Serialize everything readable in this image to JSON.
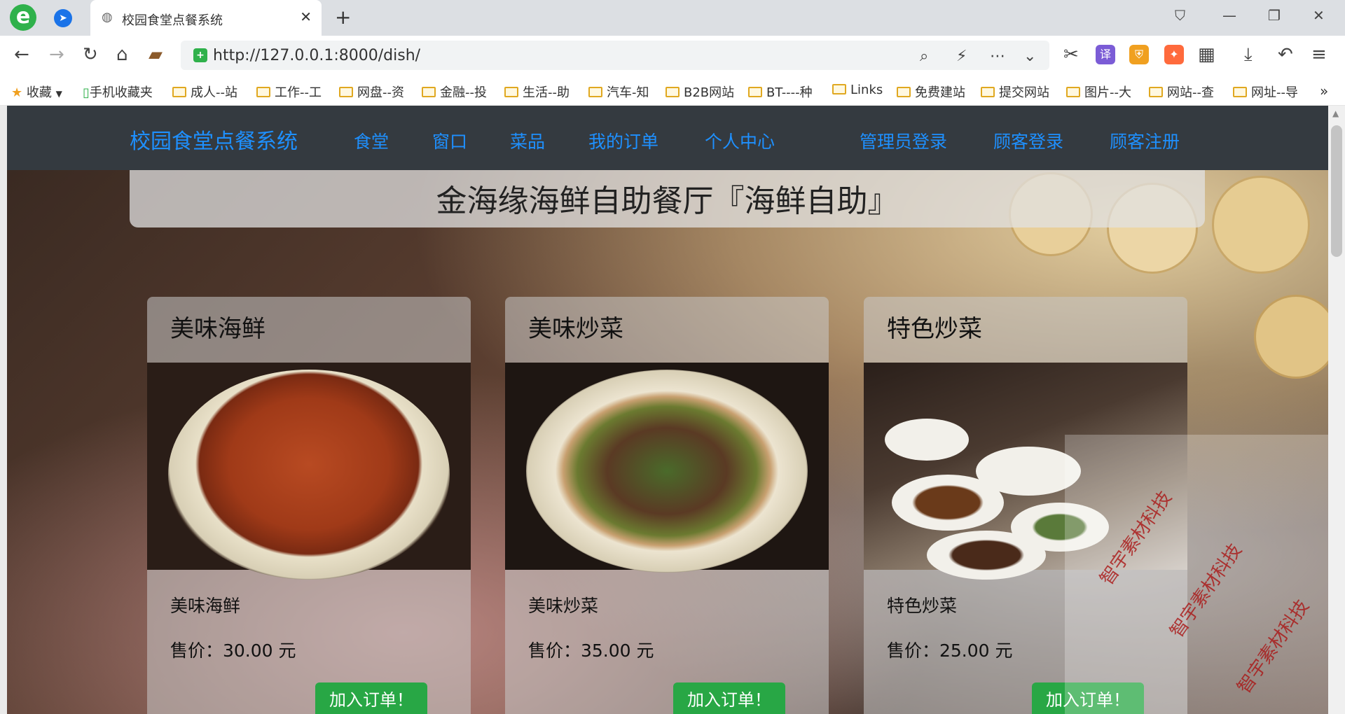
{
  "browser": {
    "tab_title": "校园食堂点餐系统",
    "url": "http://127.0.0.1:8000/dish/",
    "bookmarks": [
      "收藏",
      "手机收藏夹",
      "成人--站",
      "工作--工",
      "网盘--资",
      "金融--投",
      "生活--助",
      "汽车-知",
      "B2B网站",
      "BT----种",
      "Links",
      "免费建站",
      "提交网站",
      "图片--大",
      "网站--查",
      "网址--导"
    ],
    "ext_translate": "译"
  },
  "navbar": {
    "brand": "校园食堂点餐系统",
    "links": [
      "食堂",
      "窗口",
      "菜品",
      "我的订单",
      "个人中心",
      "管理员登录",
      "顾客登录",
      "顾客注册"
    ]
  },
  "hero_title": "金海缘海鲜自助餐厅『海鲜自助』",
  "dishes": [
    {
      "category": "美味海鲜",
      "name": "美味海鲜",
      "price": "售价：30.00 元",
      "button": "加入订单！",
      "photo": "crayfish-plate"
    },
    {
      "category": "美味炒菜",
      "name": "美味炒菜",
      "price": "售价：35.00 元",
      "button": "加入订单！",
      "photo": "green-bean-stirfry"
    },
    {
      "category": "特色炒菜",
      "name": "特色炒菜",
      "price": "售价：25.00 元",
      "button": "加入订单！",
      "photo": "buffet-plates"
    }
  ],
  "watermark": "智宇素材科技",
  "colors": {
    "navbar_bg": "#343a40",
    "nav_link": "#1e90ff",
    "button": "#28a745"
  }
}
